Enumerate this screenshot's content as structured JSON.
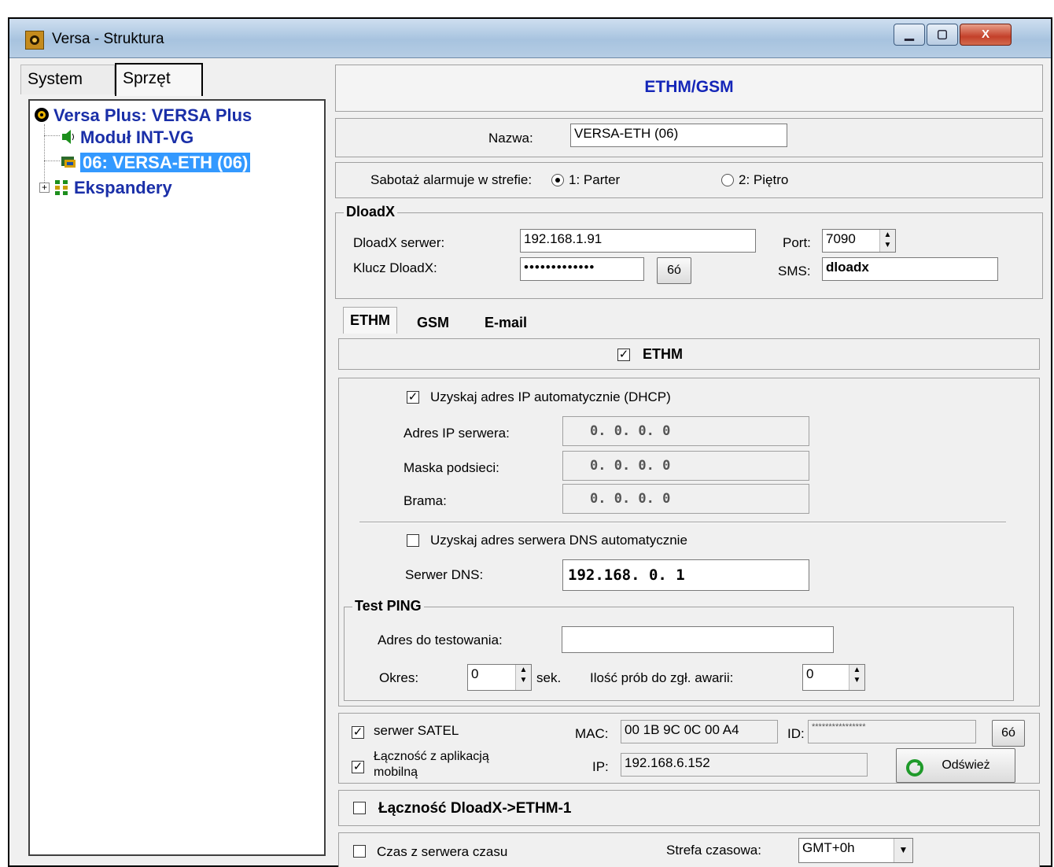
{
  "window": {
    "title": "Versa - Struktura",
    "controls": {
      "minimize": "▁",
      "maximize": "▢",
      "close": "X"
    }
  },
  "left": {
    "tabs": [
      "System",
      "Sprzęt"
    ],
    "tree": [
      {
        "label": "Versa Plus: VERSA Plus",
        "icon": "control-panel-icon"
      },
      {
        "label": "Moduł INT-VG",
        "icon": "speaker-icon"
      },
      {
        "label": "06: VERSA-ETH   (06)",
        "icon": "ethernet-module-icon",
        "selected": true
      },
      {
        "label": "Ekspandery",
        "icon": "expanders-icon"
      }
    ],
    "expand_symbol": "+"
  },
  "right": {
    "header": "ETHM/GSM",
    "name_label": "Nazwa:",
    "name_value": "VERSA-ETH  (06)",
    "tamper_label": "Sabotaż alarmuje w strefie:",
    "tamper_options": [
      "1: Parter",
      "2: Piętro"
    ],
    "tamper_selected": "1: Parter",
    "dloadx": {
      "legend": "DloadX",
      "server_label": "DloadX serwer:",
      "server_value": "192.168.1.91",
      "key_label": "Klucz DloadX:",
      "key_value": "•••••••••••••",
      "show_key_button": "6ó",
      "port_label": "Port:",
      "port_value": "7090",
      "sms_label": "SMS:",
      "sms_value": "dloadx"
    },
    "tabs": [
      "ETHM",
      "GSM",
      "E-mail"
    ],
    "ethm_check_label": "ETHM",
    "dhcp_label": "Uzyskaj adres IP automatycznie (DHCP)",
    "server_ip_label": "Adres IP serwera:",
    "server_ip": "0.   0.   0.   0",
    "mask_label": "Maska podsieci:",
    "mask": "0.   0.   0.   0",
    "gateway_label": "Brama:",
    "gateway": "0.   0.   0.   0",
    "dns_auto_label": "Uzyskaj adres serwera DNS automatycznie",
    "dns_label": "Serwer DNS:",
    "dns_value": "192.168.   0.   1",
    "ping": {
      "legend": "Test PING",
      "address_label": "Adres do testowania:",
      "address_value": "",
      "period_label": "Okres:",
      "period_value": "0",
      "period_unit": "sek.",
      "attempts_label": "Ilość prób do zgł. awarii:",
      "attempts_value": "0"
    },
    "satel_label": "serwer SATEL",
    "mac_label": "MAC:",
    "mac_value": "00 1B 9C 0C 00 A4",
    "id_label": "ID:",
    "id_value": "****************",
    "id_show_button": "6ó",
    "mobile_label_1": "Łączność z aplikacją",
    "mobile_label_2": "mobilną",
    "ip_label": "IP:",
    "ip_value": "192.168.6.152",
    "refresh_button": "Odśwież",
    "dloadx_ethm_label": "Łączność DloadX->ETHM-1",
    "time_server_label": "Czas z serwera czasu",
    "timezone_label": "Strefa czasowa:",
    "timezone_value": "GMT+0h",
    "checkmark": "✓",
    "spin_up": "▲",
    "spin_down": "▼",
    "dropdown_arrow": "▼"
  }
}
